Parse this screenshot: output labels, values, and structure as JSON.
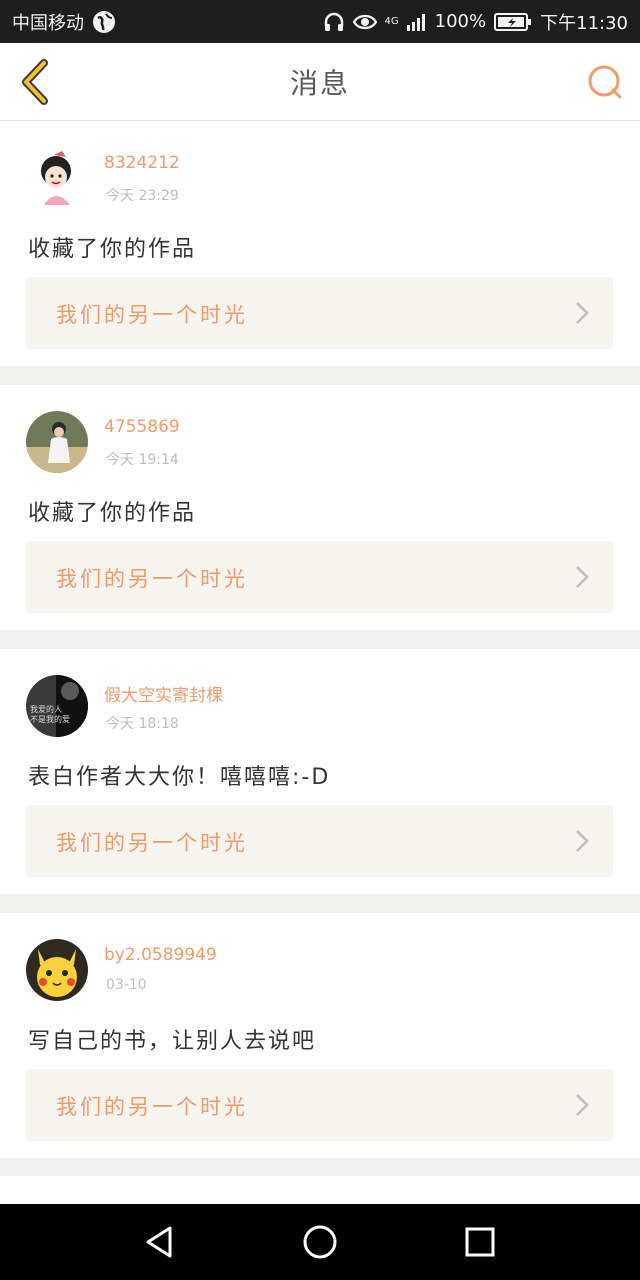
{
  "status_bar": {
    "carrier": "中国移动",
    "network": "4G",
    "battery": "100%",
    "time": "下午11:30"
  },
  "header": {
    "title": "消息",
    "back_icon": "back-chevron-icon",
    "search_icon": "search-icon"
  },
  "colors": {
    "accent": "#f29a6a",
    "back_accent": "#f2c230"
  },
  "messages": [
    {
      "username": "8324212",
      "time": "今天 23:29",
      "content": "收藏了你的作品",
      "work_title": "我们的另一个时光"
    },
    {
      "username": "4755869",
      "time": "今天 19:14",
      "content": "收藏了你的作品",
      "work_title": "我们的另一个时光"
    },
    {
      "username": "假大空实寄封棵",
      "time": "今天 18:18",
      "content": "表白作者大大你！嘻嘻嘻:-D",
      "work_title": "我们的另一个时光",
      "avatar_text": [
        "我爱的人",
        "不是我的爱"
      ]
    },
    {
      "username": "by2.0589949",
      "time": "03-10",
      "content": "写自己的书，让别人去说吧",
      "work_title": "我们的另一个时光"
    }
  ]
}
